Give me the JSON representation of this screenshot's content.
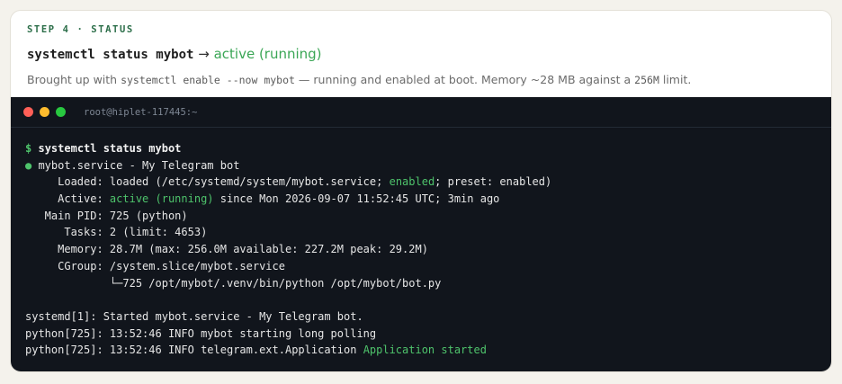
{
  "header": {
    "step_label": "STEP 4 · STATUS",
    "title_command": "systemctl status mybot",
    "title_arrow": "→",
    "title_state": "active (running)",
    "desc_prefix": "Brought up with ",
    "desc_code1": "systemctl enable --now mybot",
    "desc_middle": " — running and enabled at boot. Memory ~28 MB against a ",
    "desc_code2": "256M",
    "desc_suffix": " limit."
  },
  "terminal": {
    "host": "root@hiplet-117445:~",
    "dots": [
      "#ff5f57",
      "#febc2e",
      "#28c840"
    ],
    "prompt": "$",
    "command": "systemctl status mybot",
    "service_bullet": "●",
    "service_line": " mybot.service - My Telegram bot",
    "loaded_label": "     Loaded: ",
    "loaded_pre": "loaded (/etc/systemd/system/mybot.service; ",
    "loaded_enabled": "enabled",
    "loaded_post": "; preset: enabled)",
    "active_label": "     Active: ",
    "active_state": "active (running)",
    "active_post": " since Mon 2026-09-07 11:52:45 UTC; 3min ago",
    "mainpid": "   Main PID: 725 (python)",
    "tasks": "      Tasks: 2 (limit: 4653)",
    "memory": "     Memory: 28.7M (max: 256.0M available: 227.2M peak: 29.2M)",
    "cgroup": "     CGroup: /system.slice/mybot.service",
    "cgroup_child": "             └─725 /opt/mybot/.venv/bin/python /opt/mybot/bot.py",
    "log1": "systemd[1]: Started mybot.service - My Telegram bot.",
    "log2": "python[725]: 13:52:46 INFO mybot starting long polling",
    "log3_pre": "python[725]: 13:52:46 INFO telegram.ext.Application ",
    "log3_green": "Application started"
  },
  "colors": {
    "accent_green": "#4ec36b",
    "terminal_bg": "#11151c"
  }
}
